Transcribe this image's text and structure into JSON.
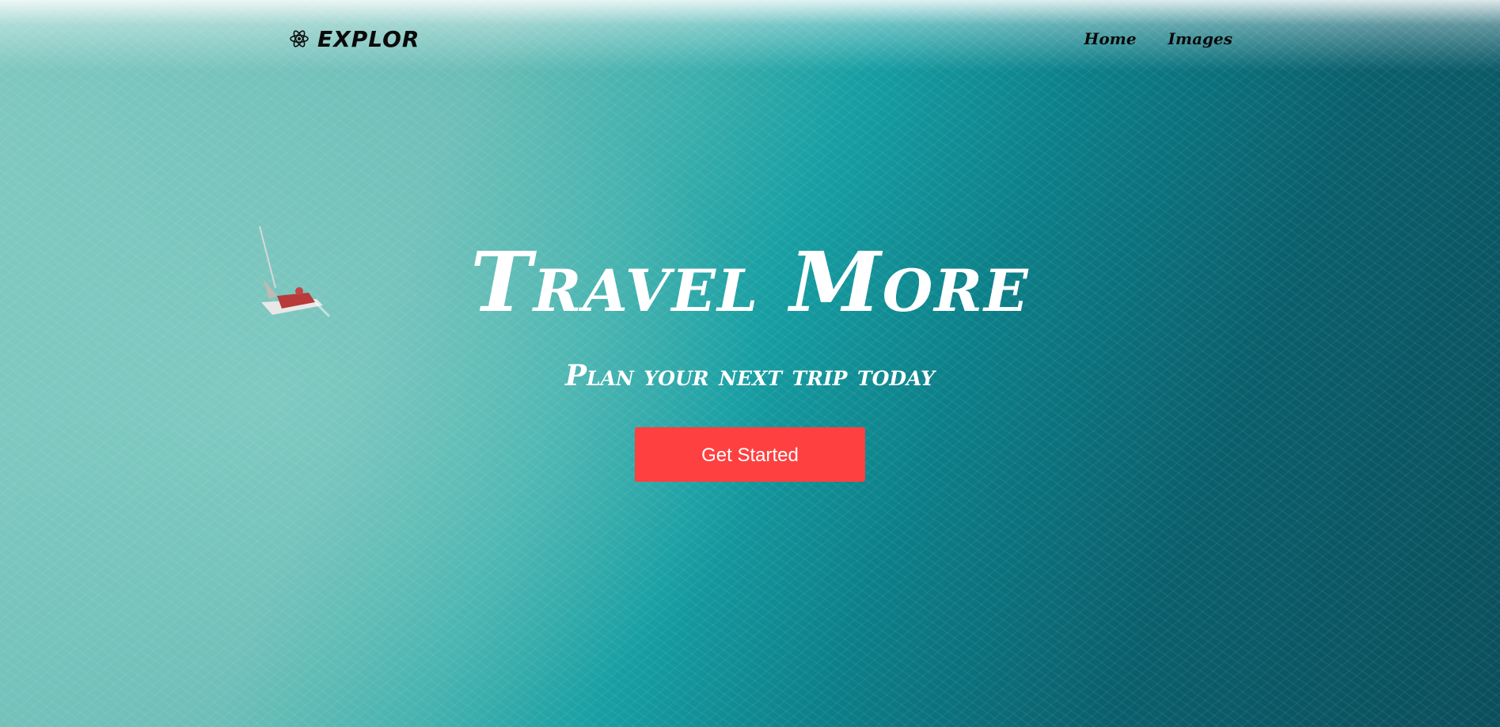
{
  "navbar": {
    "brand_icon": "atom-icon",
    "brand_name": "EXPLOR",
    "links": [
      {
        "label": "Home"
      },
      {
        "label": "Images"
      }
    ]
  },
  "hero": {
    "background_image": "aerial-ocean-with-sailboat",
    "title": "Travel More",
    "subtitle": "Plan your next trip today",
    "cta_label": "Get Started"
  },
  "colors": {
    "accent": "#ff4040",
    "text_dark": "#0a0a0a",
    "text_light": "#ffffff"
  }
}
